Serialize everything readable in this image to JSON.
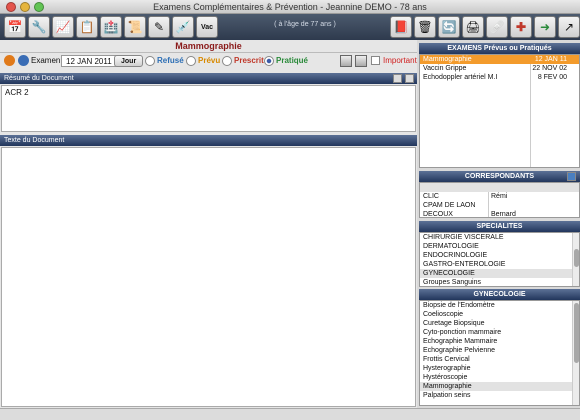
{
  "window": {
    "title": "Examens Complémentaires & Prévention - Jeannine DEMO - 78 ans"
  },
  "toolbar": {
    "age_note": "( à l'âge de 77 ans )",
    "left_icons": [
      "calendar-icon",
      "tools-icon",
      "chart-icon",
      "report-icon",
      "hospital-icon",
      "certificate-icon",
      "pen-icon",
      "syringe-icon",
      "vaccine-icon"
    ],
    "right_icons": [
      "book-icon",
      "trash-icon",
      "sync-icon",
      "printer-icon",
      "bandage-icon",
      "cross-icon",
      "arrow-icon",
      "export-icon"
    ]
  },
  "document": {
    "title": "Mammographie",
    "exam_label": "Examen",
    "date": "12 JAN 2011",
    "jour_button": "Jour",
    "status_options": [
      {
        "label": "Refusé",
        "color": "#2d6fb5",
        "selected": false
      },
      {
        "label": "Prévu",
        "color": "#d88a00",
        "selected": false
      },
      {
        "label": "Prescrit",
        "color": "#c0392b",
        "selected": false
      },
      {
        "label": "Pratiqué",
        "color": "#2a8a3a",
        "selected": true
      }
    ],
    "important_label": "Important",
    "important_color": "#d02020",
    "summary_header": "Résumé du Document",
    "summary_text": "ACR 2",
    "text_header": "Texte du Document",
    "text_body": ""
  },
  "exams": {
    "header": "EXAMENS Prévus ou Pratiqués",
    "items": [
      {
        "name": "Mammographie",
        "date": "12 JAN 11",
        "selected": true
      },
      {
        "name": "Vaccin Grippe",
        "date": "22 NOV 02",
        "selected": false
      },
      {
        "name": "Echodoppler artériel M.I",
        "date": "8 FEV 00",
        "selected": false
      }
    ]
  },
  "correspondants": {
    "header": "CORRESPONDANTS",
    "items": [
      {
        "c1": "",
        "c2": ""
      },
      {
        "c1": "CLIC",
        "c2": "Rémi"
      },
      {
        "c1": "CPAM DE LAON",
        "c2": ""
      },
      {
        "c1": "DECOUX",
        "c2": "Bernard"
      }
    ]
  },
  "specialites": {
    "header": "SPECIALITES",
    "items": [
      "CHIRURGIE VISCERALE",
      "DERMATOLOGIE",
      "ENDOCRINOLOGIE",
      "GASTRO-ENTEROLOGIE",
      "GYNECOLOGIE",
      "Groupes Sanguins"
    ],
    "highlight": 4
  },
  "gyneco": {
    "header": "GYNECOLOGIE",
    "items": [
      "Biopsie de l'Endomètre",
      "Coelioscopie",
      "Curetage Biopsique",
      "Cyto-ponction mammaire",
      "Echographie Mammaire",
      "Echographie Pelvienne",
      "Frottis Cervical",
      "Hysterographie",
      "Hystéroscopie",
      "Mammographie",
      "Palpation seins"
    ],
    "highlight": 9
  }
}
